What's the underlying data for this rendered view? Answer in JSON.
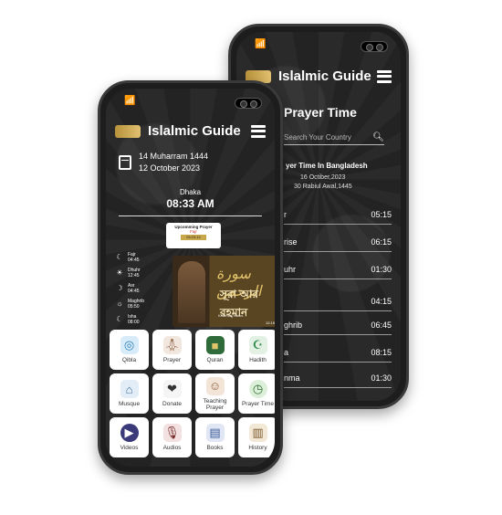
{
  "app": {
    "title": "Islalmic Guide",
    "logo_text": "Islamic Guide"
  },
  "back_screen": {
    "title": "Prayer Time",
    "search_placeholder": "Search Your Country",
    "subtitle": "yer Time In Bangladesh",
    "date_greg": "16 Octiber,2023",
    "date_hijri": "30 Rabiul Awal,1445",
    "rows": [
      {
        "name": "r",
        "time": "05:15"
      },
      {
        "name": "rise",
        "time": "06:15"
      },
      {
        "name": "uhr",
        "time": "01:30"
      },
      {
        "name": "",
        "time": "04:15"
      },
      {
        "name": "ghrib",
        "time": "06:45"
      },
      {
        "name": "a",
        "time": "08:15"
      },
      {
        "name": "nma",
        "time": "01:30"
      }
    ]
  },
  "front_screen": {
    "hijri_date": "14 Muharram 1444",
    "greg_date": "12 October 2023",
    "city": "Dhaka",
    "clock": "08:33 AM",
    "upcoming": {
      "label": "Upcomming Prayer",
      "name": "Fajr",
      "countdown": "03:23:12"
    },
    "prayers": [
      {
        "name": "Fajr",
        "time": "04:45",
        "icon": "crescent-icon"
      },
      {
        "name": "Dhuhr",
        "time": "12:45",
        "icon": "sun-icon"
      },
      {
        "name": "Asr",
        "time": "04:45",
        "icon": "crescent-icon"
      },
      {
        "name": "Maghrib",
        "time": "05:50",
        "icon": "sunset-icon"
      },
      {
        "name": "Isha",
        "time": "08:00",
        "icon": "moon-icon"
      }
    ],
    "video": {
      "arabic": "سورة الرحمن",
      "bengali": "সূরা আর রহমান",
      "brand": "Khamsul Harus",
      "time": "12:15"
    },
    "tiles": [
      {
        "label": "Qibla",
        "icon": "compass-icon"
      },
      {
        "label": "Prayer",
        "icon": "prayer-icon"
      },
      {
        "label": "Quran",
        "icon": "book-icon"
      },
      {
        "label": "Hadith",
        "icon": "hadith-icon"
      },
      {
        "label": "Musque",
        "icon": "mosque-icon"
      },
      {
        "label": "Donate",
        "icon": "donate-icon"
      },
      {
        "label": "Teaching Prayer",
        "icon": "teaching-icon"
      },
      {
        "label": "Prayer Time",
        "icon": "clock-icon"
      },
      {
        "label": "Videos",
        "icon": "play-icon"
      },
      {
        "label": "Audios",
        "icon": "microphone-icon"
      },
      {
        "label": "Books",
        "icon": "books-icon"
      },
      {
        "label": "History",
        "icon": "history-icon"
      }
    ]
  }
}
